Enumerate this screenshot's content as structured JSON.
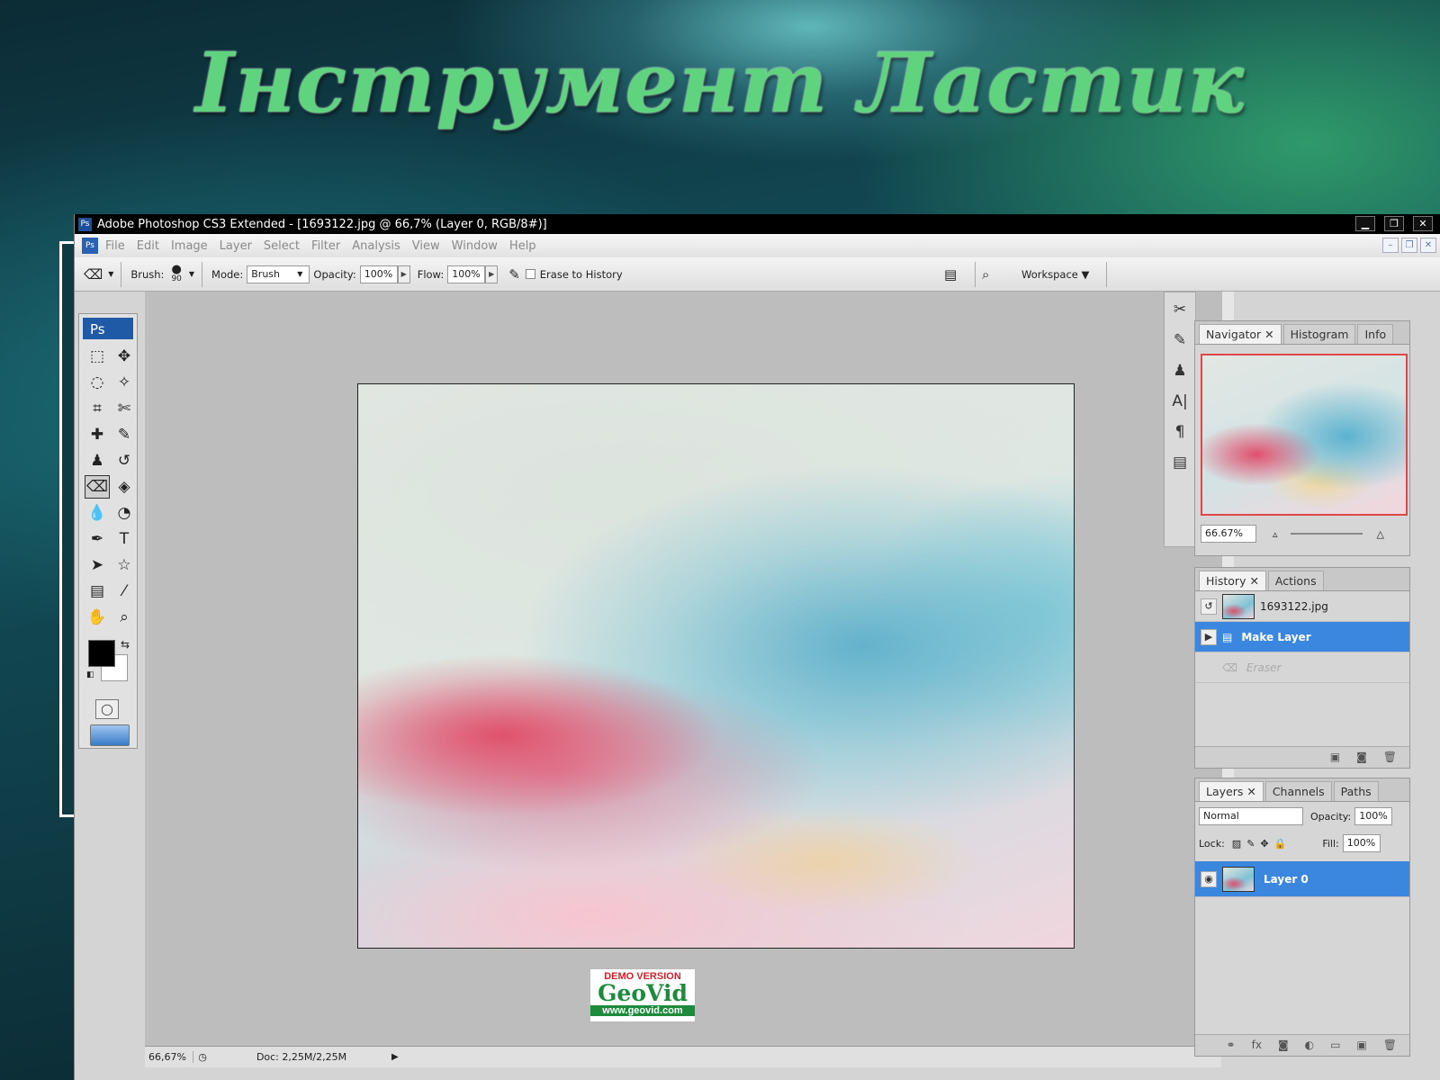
{
  "slide": {
    "title": "Інструмент Ластик"
  },
  "window": {
    "title": "Adobe Photoshop CS3 Extended - [1693122.jpg @ 66,7% (Layer 0, RGB/8#)]",
    "icon": "Ps",
    "controls": [
      "▁",
      "❐",
      "✕"
    ]
  },
  "menu": [
    "File",
    "Edit",
    "Image",
    "Layer",
    "Select",
    "Filter",
    "Analysis",
    "View",
    "Window",
    "Help"
  ],
  "options": {
    "brush_label": "Brush:",
    "brush_size": "90",
    "mode_label": "Mode:",
    "mode_value": "Brush",
    "opacity_label": "Opacity:",
    "opacity_value": "100%",
    "flow_label": "Flow:",
    "flow_value": "100%",
    "erase_label": "Erase to History",
    "workspace_label": "Workspace ▼"
  },
  "toolbox": {
    "logo": "Ps"
  },
  "status": {
    "zoom": "66,67%",
    "doc": "Doc: 2,25M/2,25M"
  },
  "watermark": {
    "line1": "DEMO VERSION",
    "line2": "GeoVid",
    "line3": "www.geovid.com"
  },
  "navigator": {
    "tabs": [
      "Navigator ✕",
      "Histogram",
      "Info"
    ],
    "zoom": "66.67%"
  },
  "history": {
    "tabs": [
      "History ✕",
      "Actions"
    ],
    "snapshot": "1693122.jpg",
    "items": [
      "Make Layer",
      "Eraser"
    ]
  },
  "layers": {
    "tabs": [
      "Layers ✕",
      "Channels",
      "Paths"
    ],
    "blend": "Normal",
    "opacity_label": "Opacity:",
    "opacity_value": "100%",
    "lock_label": "Lock:",
    "fill_label": "Fill:",
    "fill_value": "100%",
    "layer_name": "Layer 0"
  },
  "colors": {
    "accent_title": "#5fd37e",
    "selection": "#3b86de",
    "ps_blue": "#1f5aa6"
  }
}
